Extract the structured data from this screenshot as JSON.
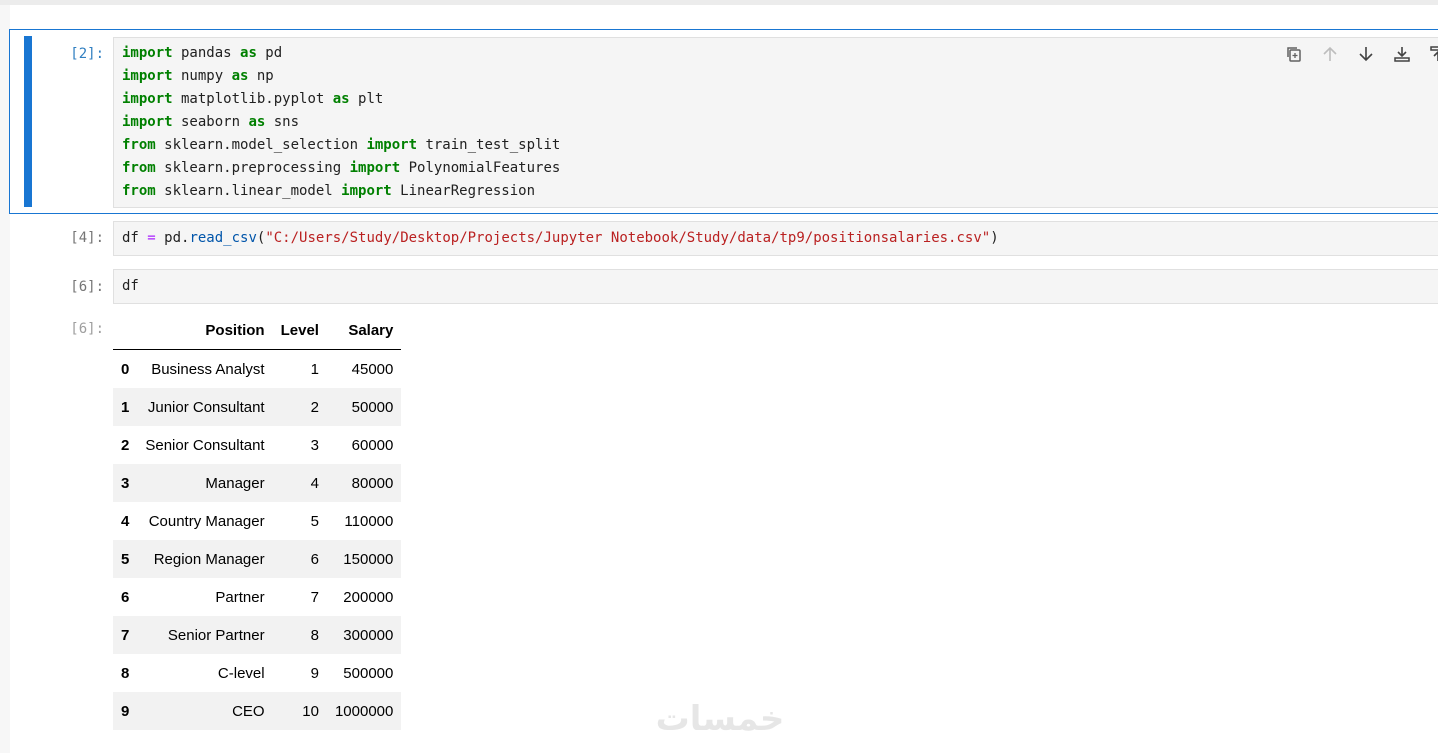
{
  "cells": [
    {
      "prompt": "[2]:",
      "lines": [
        [
          {
            "t": "import",
            "k": "kw"
          },
          {
            "t": " pandas "
          },
          {
            "t": "as",
            "k": "kw"
          },
          {
            "t": " pd"
          }
        ],
        [
          {
            "t": "import",
            "k": "kw"
          },
          {
            "t": " numpy "
          },
          {
            "t": "as",
            "k": "kw"
          },
          {
            "t": " np"
          }
        ],
        [
          {
            "t": "import",
            "k": "kw"
          },
          {
            "t": " matplotlib.pyplot "
          },
          {
            "t": "as",
            "k": "kw"
          },
          {
            "t": " plt"
          }
        ],
        [
          {
            "t": "import",
            "k": "kw"
          },
          {
            "t": " seaborn "
          },
          {
            "t": "as",
            "k": "kw"
          },
          {
            "t": " sns"
          }
        ],
        [
          {
            "t": "from",
            "k": "kw"
          },
          {
            "t": " sklearn.model_selection "
          },
          {
            "t": "import",
            "k": "kw"
          },
          {
            "t": " train_test_split"
          }
        ],
        [
          {
            "t": "from",
            "k": "kw"
          },
          {
            "t": " sklearn.preprocessing "
          },
          {
            "t": "import",
            "k": "kw"
          },
          {
            "t": " PolynomialFeatures"
          }
        ],
        [
          {
            "t": "from",
            "k": "kw"
          },
          {
            "t": " sklearn.linear_model "
          },
          {
            "t": "import",
            "k": "kw"
          },
          {
            "t": " LinearRegression"
          }
        ]
      ]
    },
    {
      "prompt": "[4]:",
      "lines": [
        [
          {
            "t": "df "
          },
          {
            "t": "=",
            "k": "op"
          },
          {
            "t": " pd."
          },
          {
            "t": "read_csv",
            "k": "fn"
          },
          {
            "t": "("
          },
          {
            "t": "\"C:/Users/Study/Desktop/Projects/Jupyter Notebook/Study/data/tp9/positionsalaries.csv\"",
            "k": "str"
          },
          {
            "t": ")"
          }
        ]
      ]
    },
    {
      "prompt": "[6]:",
      "lines": [
        [
          {
            "t": "df"
          }
        ]
      ]
    }
  ],
  "toolbar": {
    "icons": [
      "duplicate-icon",
      "move-up-icon",
      "move-down-icon",
      "insert-above-icon",
      "insert-below-icon"
    ]
  },
  "output": {
    "prompt": "[6]:",
    "columns": [
      "Position",
      "Level",
      "Salary"
    ],
    "rows": [
      {
        "index": "0",
        "Position": "Business Analyst",
        "Level": "1",
        "Salary": "45000"
      },
      {
        "index": "1",
        "Position": "Junior Consultant",
        "Level": "2",
        "Salary": "50000"
      },
      {
        "index": "2",
        "Position": "Senior Consultant",
        "Level": "3",
        "Salary": "60000"
      },
      {
        "index": "3",
        "Position": "Manager",
        "Level": "4",
        "Salary": "80000"
      },
      {
        "index": "4",
        "Position": "Country Manager",
        "Level": "5",
        "Salary": "110000"
      },
      {
        "index": "5",
        "Position": "Region Manager",
        "Level": "6",
        "Salary": "150000"
      },
      {
        "index": "6",
        "Position": "Partner",
        "Level": "7",
        "Salary": "200000"
      },
      {
        "index": "7",
        "Position": "Senior Partner",
        "Level": "8",
        "Salary": "300000"
      },
      {
        "index": "8",
        "Position": "C-level",
        "Level": "9",
        "Salary": "500000"
      },
      {
        "index": "9",
        "Position": "CEO",
        "Level": "10",
        "Salary": "1000000"
      }
    ]
  },
  "watermark": {
    "text": "خمسات"
  },
  "colors": {
    "accent": "#1976d2",
    "keyword": "#008000",
    "string": "#ba2121",
    "operator": "#aa22ff"
  }
}
